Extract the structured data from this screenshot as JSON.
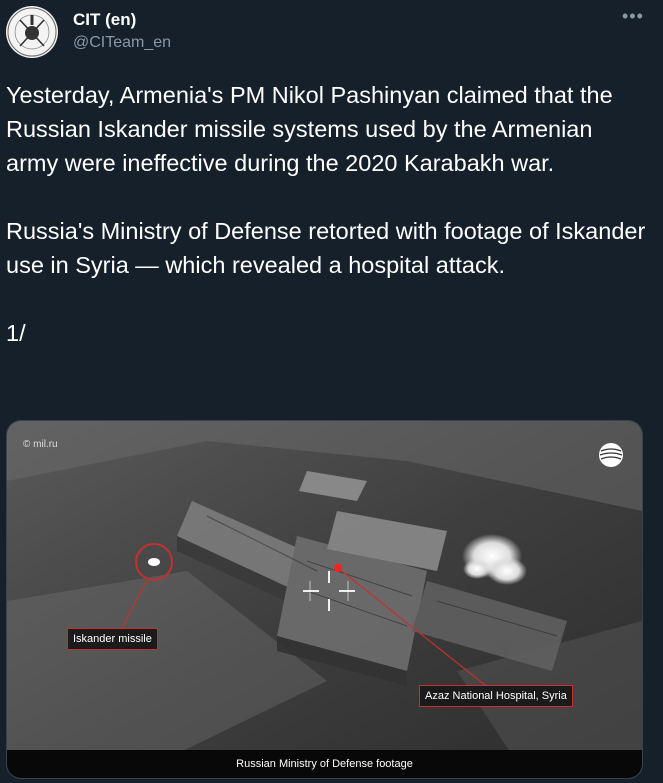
{
  "author": {
    "name": "CIT (en)",
    "handle": "@CITeam_en"
  },
  "tweet": {
    "text": "Yesterday, Armenia's PM Nikol Pashinyan claimed that the Russian Iskander missile systems used by the Armenian army were ineffective during the 2020 Karabakh war.\n\nRussia's Ministry of Defense retorted with footage of Iskander use in Syria — which revealed a hospital attack.\n\n1/"
  },
  "more_label": "•••",
  "media": {
    "watermark": "© mil.ru",
    "missile_label": "Iskander missile",
    "hospital_label": "Azaz National Hospital, Syria",
    "caption": "Russian Ministry of Defense footage"
  },
  "colors": {
    "background": "#15202b",
    "secondary_text": "#8899a6",
    "annotation_red": "#c43030"
  }
}
